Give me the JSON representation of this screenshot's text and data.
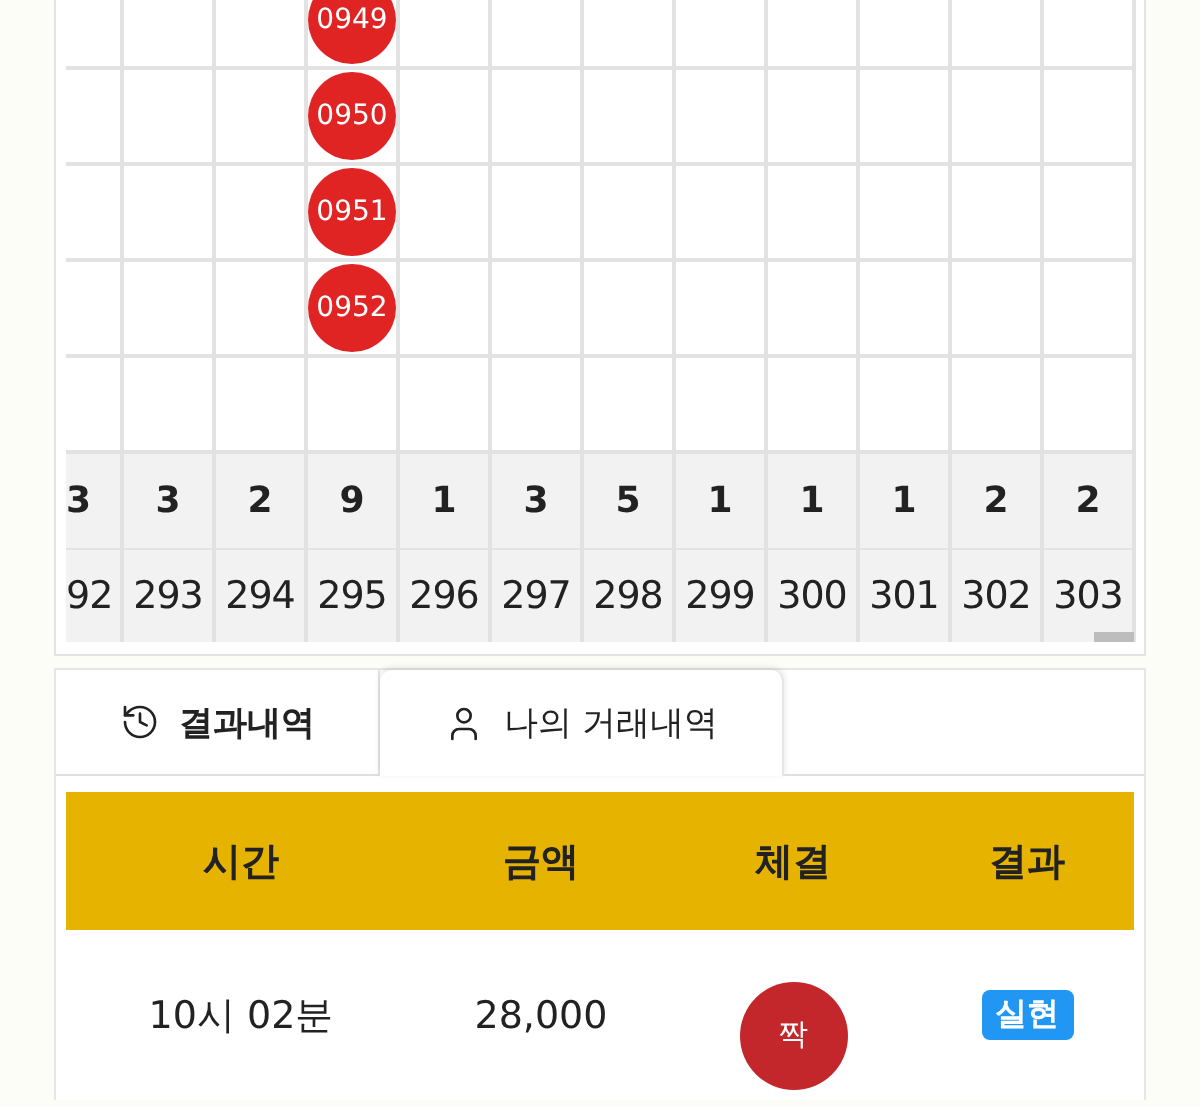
{
  "grid": {
    "columns": [
      {
        "count": "3",
        "number": "92"
      },
      {
        "count": "3",
        "number": "293"
      },
      {
        "count": "2",
        "number": "294"
      },
      {
        "count": "9",
        "number": "295",
        "marks": [
          "0949",
          "0950",
          "0951",
          "0952"
        ]
      },
      {
        "count": "1",
        "number": "296"
      },
      {
        "count": "3",
        "number": "297"
      },
      {
        "count": "5",
        "number": "298"
      },
      {
        "count": "1",
        "number": "299"
      },
      {
        "count": "1",
        "number": "300"
      },
      {
        "count": "1",
        "number": "301"
      },
      {
        "count": "2",
        "number": "302"
      },
      {
        "count": "2",
        "number": "303"
      }
    ]
  },
  "tabs": [
    {
      "label": "결과내역",
      "selected": false
    },
    {
      "label": "나의 거래내역",
      "selected": true
    }
  ],
  "table": {
    "columns": [
      "시간",
      "금액",
      "체결",
      "결과"
    ],
    "rows": [
      {
        "time": "10시 02분",
        "amount": "28,000",
        "trade": "짝",
        "result": "실현"
      }
    ]
  }
}
